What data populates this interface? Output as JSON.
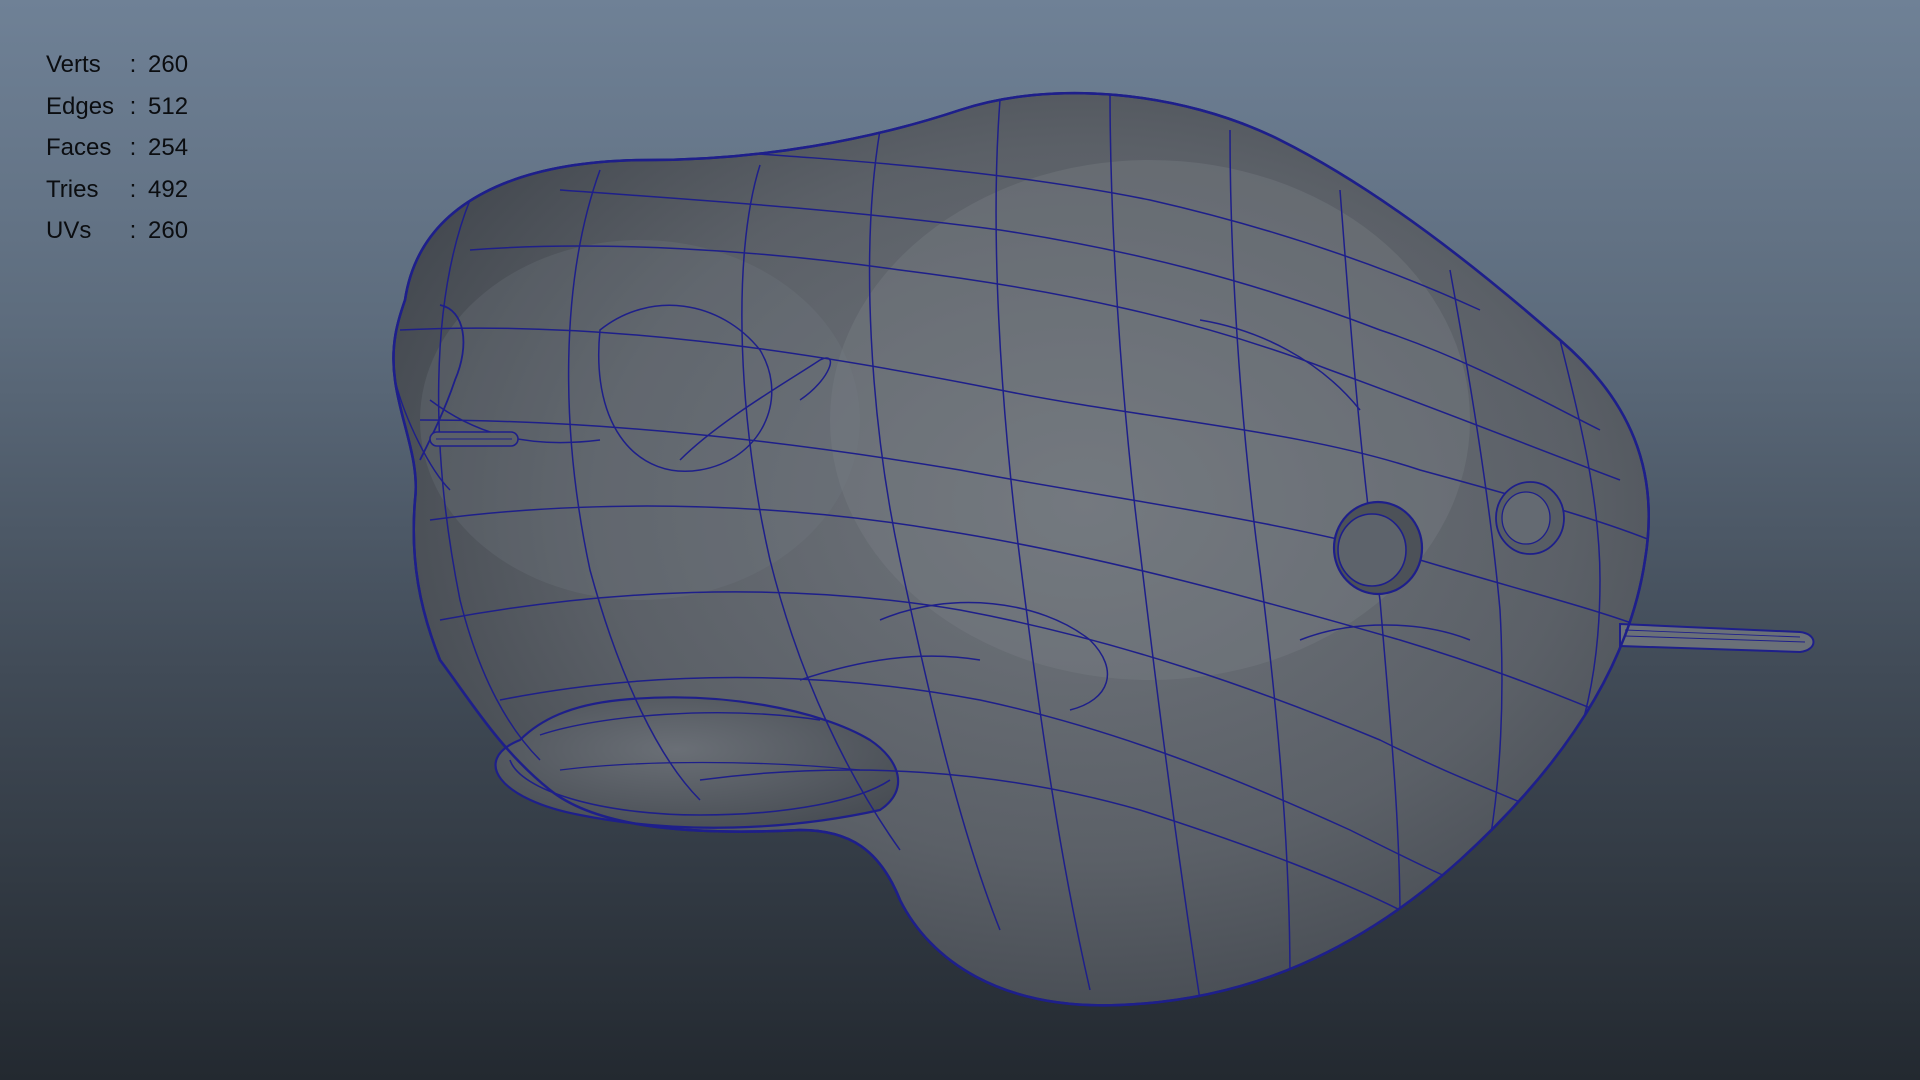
{
  "stats": {
    "rows": [
      {
        "label": "Verts",
        "sep": ":",
        "value": "260"
      },
      {
        "label": "Edges",
        "sep": ":",
        "value": "512"
      },
      {
        "label": "Faces",
        "sep": ":",
        "value": "254"
      },
      {
        "label": "Tries",
        "sep": ":",
        "value": "492"
      },
      {
        "label": "UVs",
        "sep": ":",
        "value": "260"
      }
    ]
  },
  "colors": {
    "wireframe": "#1e1f8a",
    "surface": "#555b63",
    "background_top": "#6f8196",
    "background_bottom": "#232930"
  },
  "icons": {
    "model": "wireframe-head-model-icon"
  }
}
